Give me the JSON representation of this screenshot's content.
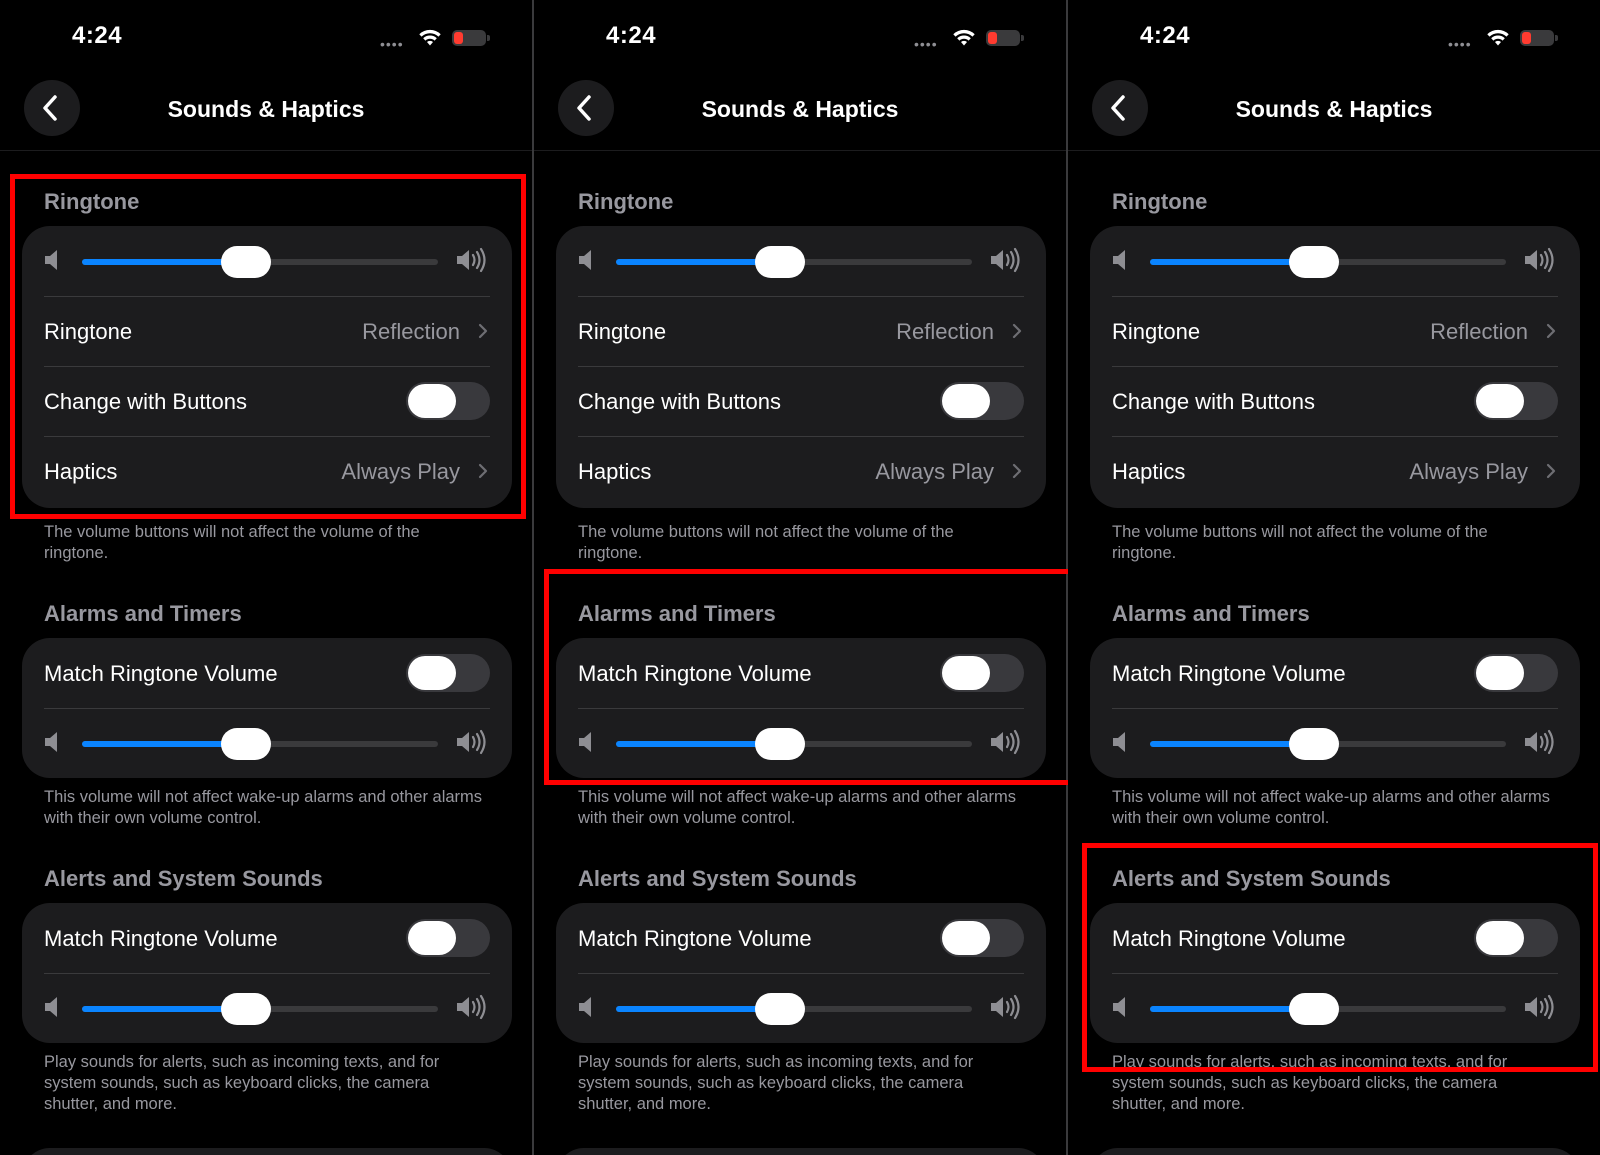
{
  "panels": [
    {
      "time": "4:24",
      "title": "Sounds & Haptics",
      "ringtone": {
        "header": "Ringtone",
        "volume": 0.46,
        "ringtone_label": "Ringtone",
        "ringtone_value": "Reflection",
        "change_label": "Change with Buttons",
        "change_on": false,
        "haptics_label": "Haptics",
        "haptics_value": "Always Play",
        "footer": "The volume buttons will not affect the volume of the ringtone."
      },
      "alarms": {
        "header": "Alarms and Timers",
        "match_label": "Match Ringtone Volume",
        "match_on": false,
        "volume": 0.46,
        "footer": "This volume will not affect wake-up alarms and other alarms with their own volume control."
      },
      "alerts": {
        "header": "Alerts and System Sounds",
        "match_label": "Match Ringtone Volume",
        "match_on": false,
        "volume": 0.46,
        "footer": "Play sounds for alerts, such as incoming texts, and for system sounds, such as keyboard clicks, the camera shutter, and more."
      },
      "highlighted_section": "ringtone"
    },
    {
      "time": "4:24",
      "title": "Sounds & Haptics",
      "ringtone": {
        "header": "Ringtone",
        "volume": 0.46,
        "ringtone_label": "Ringtone",
        "ringtone_value": "Reflection",
        "change_label": "Change with Buttons",
        "change_on": false,
        "haptics_label": "Haptics",
        "haptics_value": "Always Play",
        "footer": "The volume buttons will not affect the volume of the ringtone."
      },
      "alarms": {
        "header": "Alarms and Timers",
        "match_label": "Match Ringtone Volume",
        "match_on": false,
        "volume": 0.46,
        "footer": "This volume will not affect wake-up alarms and other alarms with their own volume control."
      },
      "alerts": {
        "header": "Alerts and System Sounds",
        "match_label": "Match Ringtone Volume",
        "match_on": false,
        "volume": 0.46,
        "footer": "Play sounds for alerts, such as incoming texts, and for system sounds, such as keyboard clicks, the camera shutter, and more."
      },
      "highlighted_section": "alarms"
    },
    {
      "time": "4:24",
      "title": "Sounds & Haptics",
      "ringtone": {
        "header": "Ringtone",
        "volume": 0.46,
        "ringtone_label": "Ringtone",
        "ringtone_value": "Reflection",
        "change_label": "Change with Buttons",
        "change_on": false,
        "haptics_label": "Haptics",
        "haptics_value": "Always Play",
        "footer": "The volume buttons will not affect the volume of the ringtone."
      },
      "alarms": {
        "header": "Alarms and Timers",
        "match_label": "Match Ringtone Volume",
        "match_on": false,
        "volume": 0.46,
        "footer": "This volume will not affect wake-up alarms and other alarms with their own volume control."
      },
      "alerts": {
        "header": "Alerts and System Sounds",
        "match_label": "Match Ringtone Volume",
        "match_on": false,
        "volume": 0.46,
        "footer": "Play sounds for alerts, such as incoming texts, and for system sounds, such as keyboard clicks, the camera shutter, and more."
      },
      "highlighted_section": "alerts"
    }
  ],
  "colors": {
    "accent": "#0a84ff",
    "highlight": "#ff0000",
    "card": "#1c1c1e",
    "secondary_text": "#98989f",
    "battery": "#ff3b30"
  }
}
